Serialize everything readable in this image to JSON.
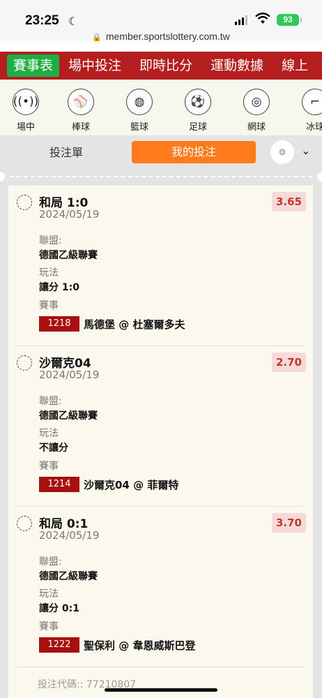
{
  "status": {
    "time": "23:25",
    "battery": "93"
  },
  "browser": {
    "url": "member.sportslottery.com.tw"
  },
  "topnav": [
    "賽事表",
    "場中投注",
    "即時比分",
    "運動數據",
    "線上"
  ],
  "sports": [
    {
      "label": "場中",
      "icon": "live-signal-icon"
    },
    {
      "label": "棒球",
      "icon": "baseball-icon"
    },
    {
      "label": "籃球",
      "icon": "basketball-icon"
    },
    {
      "label": "足球",
      "icon": "soccer-icon"
    },
    {
      "label": "網球",
      "icon": "tennis-icon"
    },
    {
      "label": "冰球",
      "icon": "hockey-icon"
    }
  ],
  "panel": {
    "tab_slip": "投注單",
    "tab_mine": "我的投注"
  },
  "labels": {
    "league": "聯盟:",
    "play": "玩法",
    "event": "賽事"
  },
  "bets": [
    {
      "pick": "和局 1:0",
      "date": "2024/05/19",
      "odds": "3.65",
      "league": "德國乙級聯賽",
      "play": "讓分 1:0",
      "event_id": "1218",
      "match": "馬德堡 @ 杜塞爾多夫"
    },
    {
      "pick": "沙爾克04",
      "date": "2024/05/19",
      "odds": "2.70",
      "league": "德國乙級聯賽",
      "play": "不讓分",
      "event_id": "1214",
      "match": "沙爾克04 @ 菲爾特"
    },
    {
      "pick": "和局 0:1",
      "date": "2024/05/19",
      "odds": "3.70",
      "league": "德國乙級聯賽",
      "play": "讓分 0:1",
      "event_id": "1222",
      "match": "聖保利 @ 韋恩威斯巴登"
    }
  ],
  "bet_code": "投注代碼:: 77210807",
  "colors": {
    "nav_red": "#b41e1e",
    "active_green": "#1fae44",
    "accent_orange": "#ff7a1a",
    "odds_red": "#c0392b"
  }
}
